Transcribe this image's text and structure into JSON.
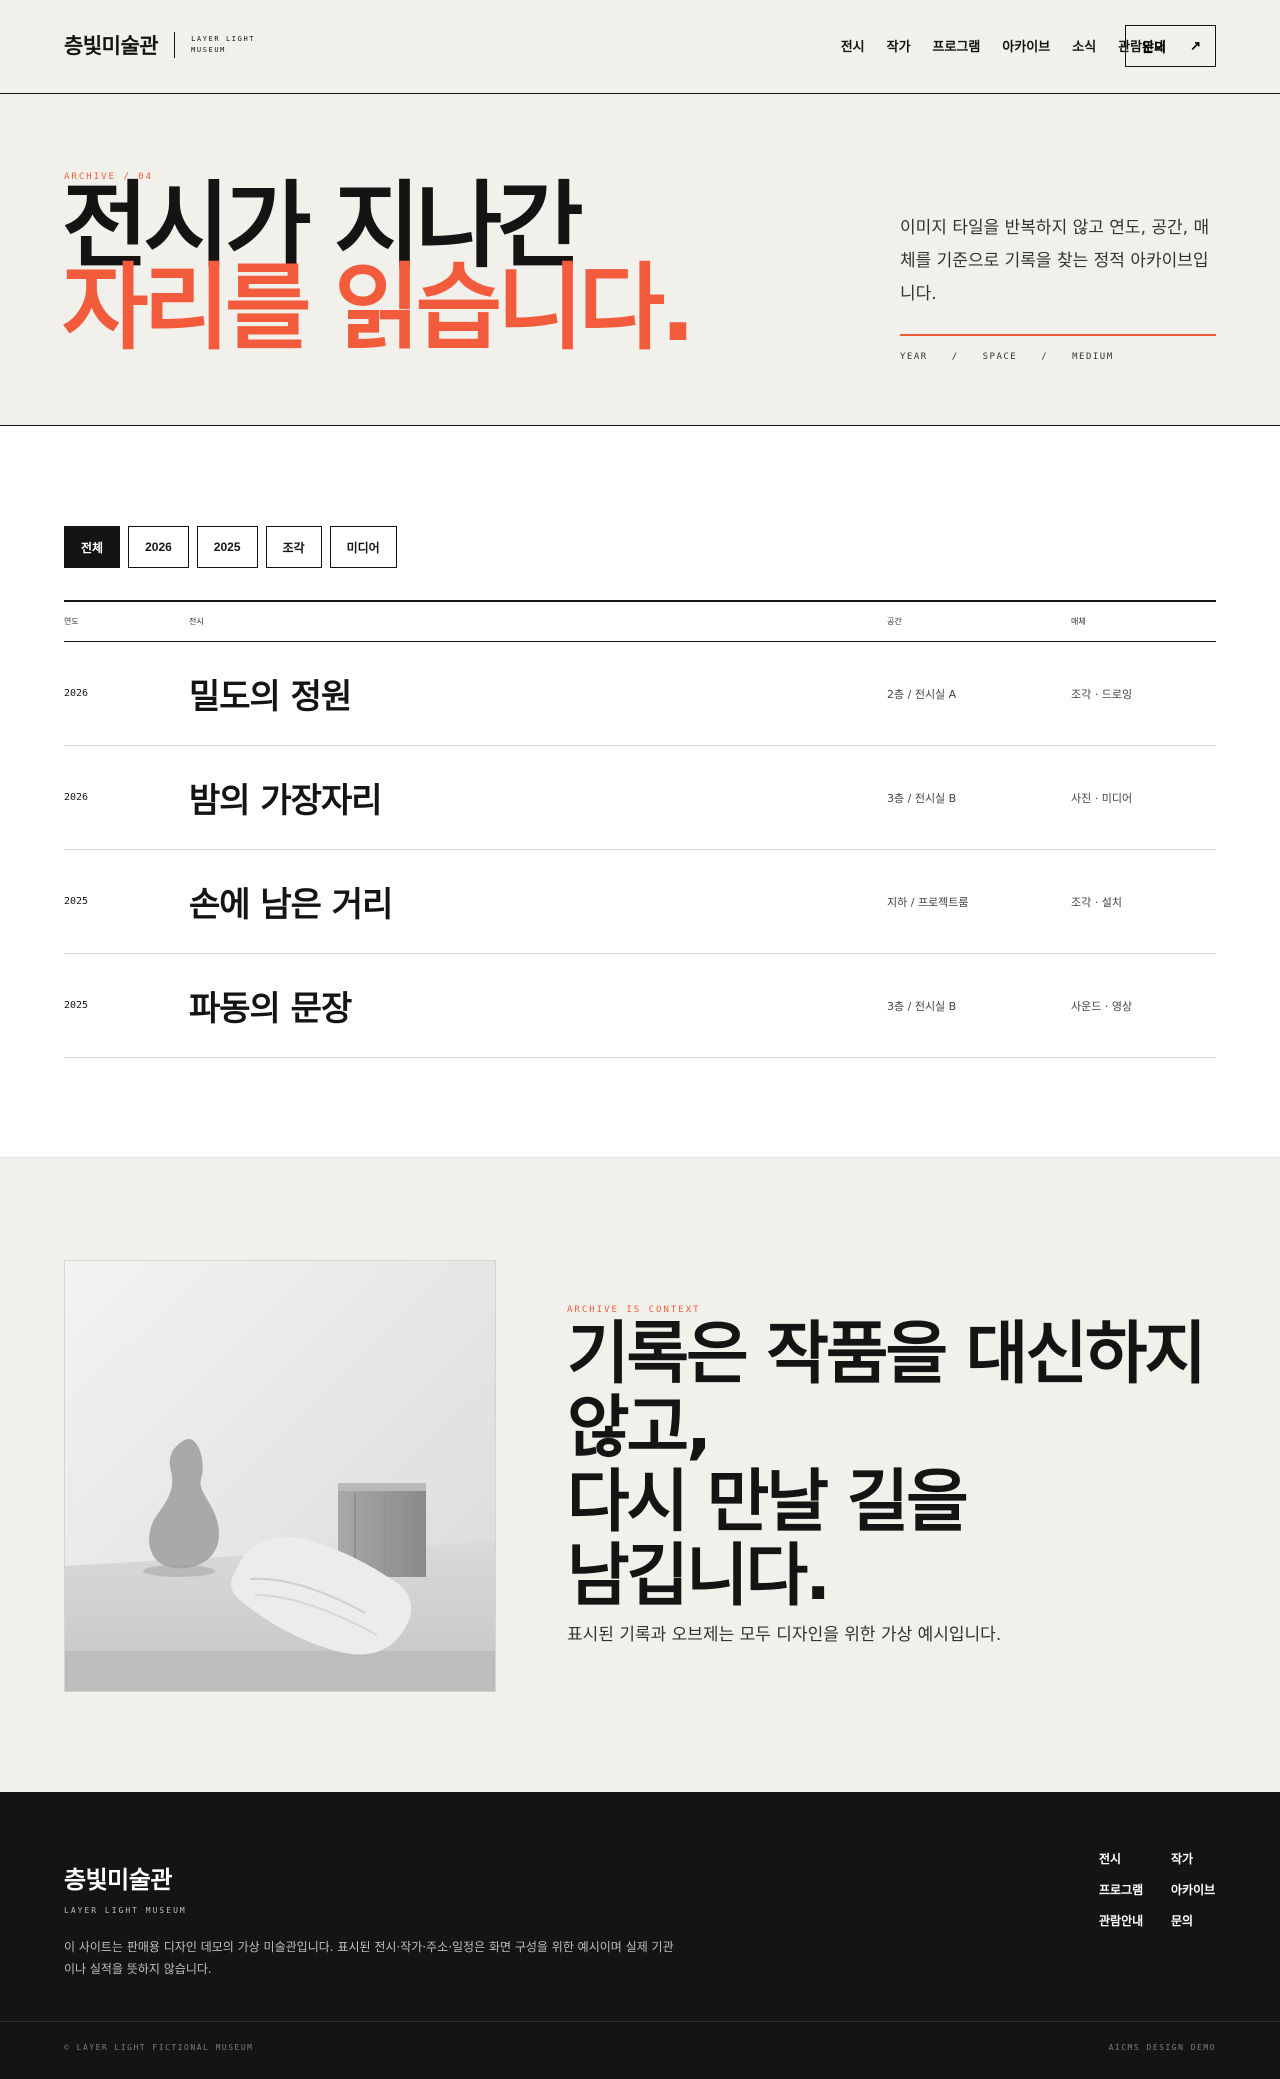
{
  "header": {
    "brand": "층빛미술관",
    "brand_sub": "LAYER LIGHT MUSEUM",
    "nav": [
      "전시",
      "작가",
      "프로그램",
      "아카이브",
      "소식",
      "관람안내"
    ],
    "contact_label": "문의",
    "contact_arrow": "↗"
  },
  "hero": {
    "eyebrow": "ARCHIVE / 04",
    "title_line1": "전시가 지나간",
    "title_line2": "자리를 읽습니다.",
    "description": "이미지 타일을 반복하지 않고 연도, 공간, 매체를 기준으로 기록을 찾는 정적 아카이브입니다.",
    "tags": [
      "YEAR",
      "/",
      "SPACE",
      "/",
      "MEDIUM"
    ]
  },
  "archive": {
    "filters": [
      "전체",
      "2026",
      "2025",
      "조각",
      "미디어"
    ],
    "active_filter": "전체",
    "columns": [
      "연도",
      "전시",
      "공간",
      "매체"
    ],
    "rows": [
      {
        "year": "2026",
        "title": "밀도의 정원",
        "space": "2층 / 전시실 A",
        "medium": "조각 · 드로잉"
      },
      {
        "year": "2026",
        "title": "밤의 가장자리",
        "space": "3층 / 전시실 B",
        "medium": "사진 · 미디어"
      },
      {
        "year": "2025",
        "title": "손에 남은 거리",
        "space": "지하 / 프로젝트룸",
        "medium": "조각 · 설치"
      },
      {
        "year": "2025",
        "title": "파동의 문장",
        "space": "3층 / 전시실 B",
        "medium": "사운드 · 영상"
      }
    ]
  },
  "context": {
    "eyebrow": "ARCHIVE IS CONTEXT",
    "title_line1": "기록은 작품을 대신하지",
    "title_line2": "않고,",
    "title_line3": "다시 만날 길을",
    "title_line4": "남깁니다.",
    "note": "표시된 기록과 오브제는 모두 디자인을 위한 가상 예시입니다."
  },
  "footer": {
    "brand": "층빛미술관",
    "brand_sub": "LAYER LIGHT MUSEUM",
    "description": "이 사이트는 판매용 디자인 데모의 가상 미술관입니다. 표시된 전시·작가·주소·일정은 화면 구성을 위한 예시이며 실제 기관이나 실적을 뜻하지 않습니다.",
    "nav": [
      "전시",
      "작가",
      "프로그램",
      "아카이브",
      "관람안내",
      "문의"
    ],
    "copyright": "© LAYER LIGHT FICTIONAL MUSEUM",
    "credit": "AICMS DESIGN DEMO"
  },
  "colors": {
    "accent": "#f25c3c",
    "ink": "#141414",
    "paper": "#f2f0eb"
  }
}
